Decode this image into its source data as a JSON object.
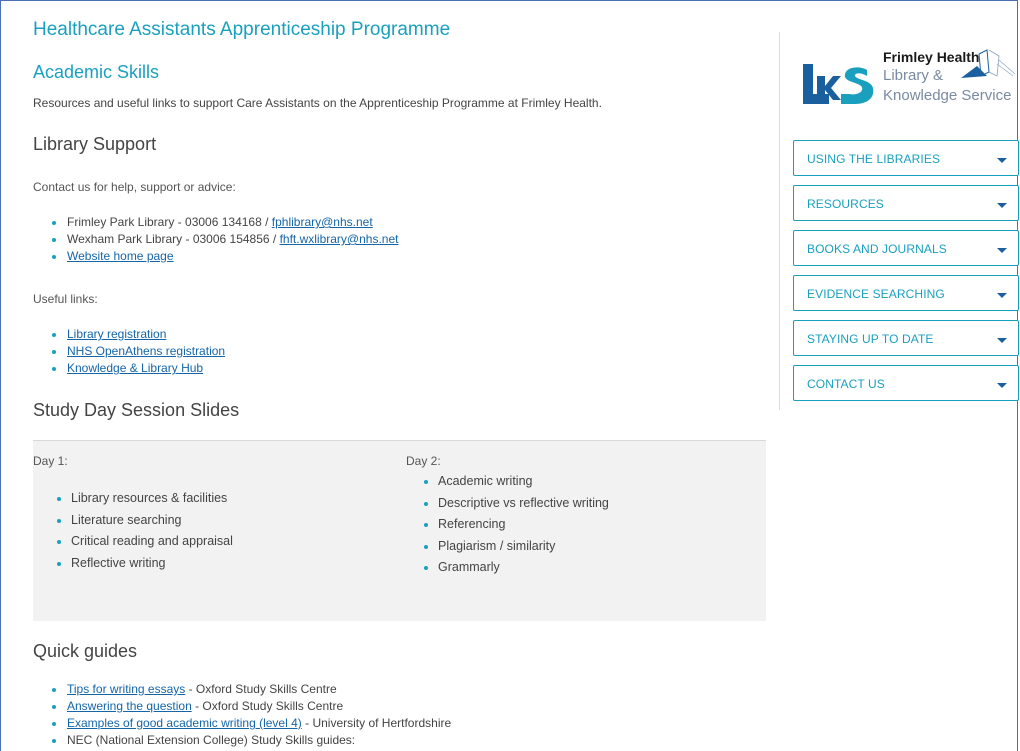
{
  "page_title": "Healthcare Assistants Apprenticeship Programme",
  "section_title": "Academic Skills",
  "intro": "Resources and useful links to support Care Assistants on the Apprenticeship Programme at Frimley Health.",
  "library_support": {
    "heading": "Library Support",
    "contact_text": "Contact us for help, support or advice:",
    "contacts": [
      {
        "text": "Frimley Park Library - 03006 134168 / ",
        "link": "fphlibrary@nhs.net"
      },
      {
        "text": "Wexham Park Library - 03006 154856 / ",
        "link": "fhft.wxlibrary@nhs.net"
      },
      {
        "text": "",
        "link": "Website home page"
      }
    ],
    "useful_links_text": "Useful links:",
    "useful_links": [
      "Library registration",
      "NHS OpenAthens registration",
      "Knowledge & Library Hub"
    ]
  },
  "study_day": {
    "heading": "Study Day Session Slides",
    "day1_label": "Day 1:",
    "day1_items": [
      "Library resources & facilities",
      "Literature searching",
      "Critical reading and appraisal",
      "Reflective writing"
    ],
    "day2_label": "Day 2:",
    "day2_items": [
      "Academic writing",
      "Descriptive vs reflective writing",
      "Referencing",
      "Plagiarism / similarity",
      "Grammarly"
    ]
  },
  "quick_guides": {
    "heading": "Quick guides",
    "items": [
      {
        "link": "Tips for writing essays",
        "text": " - Oxford Study Skills Centre"
      },
      {
        "link": "Answering the question",
        "text": " - Oxford Study Skills Centre"
      },
      {
        "link": "Examples of good academic writing (level 4)",
        "text": " - University of Hertfordshire"
      },
      {
        "link": "",
        "text": "NEC (National Extension College) Study Skills guides:"
      }
    ]
  },
  "logo": {
    "letters": "LKS",
    "line1": "Frimley Health",
    "line2": "Library &",
    "line3": "Knowledge Service"
  },
  "nav": [
    "USING THE LIBRARIES",
    "RESOURCES",
    "BOOKS AND JOURNALS",
    "EVIDENCE SEARCHING",
    "STAYING UP TO DATE",
    "CONTACT US"
  ],
  "colors": {
    "accent": "#1aa0be",
    "link": "#1565a8",
    "logo_blue": "#1a5f9e"
  }
}
